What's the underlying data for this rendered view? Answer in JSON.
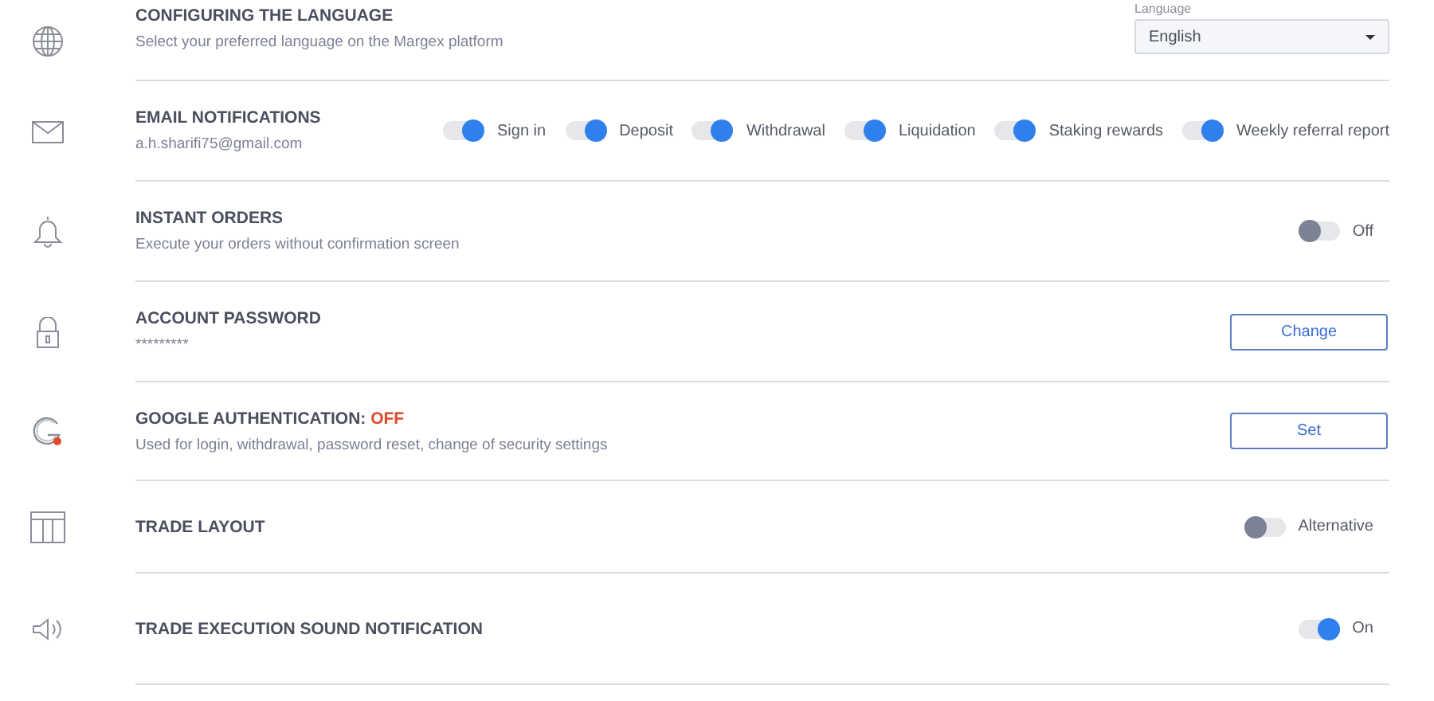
{
  "settings": [
    {
      "kind": "select",
      "title": "CONFIGURING THE LANGUAGE",
      "subtitle": "Select your preferred language on the Margex platform",
      "select": {
        "label": "Language",
        "value": "English"
      }
    },
    {
      "kind": "toggles",
      "title": "EMAIL NOTIFICATIONS",
      "subtitle": "a.h.sharifi75@gmail.com",
      "toggles": [
        {
          "label": "Sign in",
          "on": true
        },
        {
          "label": "Deposit",
          "on": true
        },
        {
          "label": "Withdrawal",
          "on": true
        },
        {
          "label": "Liquidation",
          "on": true
        },
        {
          "label": "Staking rewards",
          "on": true
        },
        {
          "label": "Weekly referral report",
          "on": true
        }
      ]
    },
    {
      "kind": "toggle",
      "title": "INSTANT ORDERS",
      "subtitle": "Execute your orders without confirmation screen",
      "toggle": {
        "label": "Off",
        "on": false
      }
    },
    {
      "kind": "button",
      "title": "ACCOUNT PASSWORD",
      "subtitle": "*********",
      "button": "Change"
    },
    {
      "kind": "button",
      "title": "GOOGLE AUTHENTICATION:",
      "status": "OFF",
      "subtitle": "Used for login, withdrawal, password reset, change of security settings",
      "button": "Set"
    },
    {
      "kind": "toggle",
      "title": "TRADE LAYOUT",
      "toggle": {
        "label": "Alternative",
        "on": false
      }
    },
    {
      "kind": "toggle",
      "title": "TRADE EXECUTION SOUND NOTIFICATION",
      "toggle": {
        "label": "On",
        "on": true
      }
    }
  ]
}
